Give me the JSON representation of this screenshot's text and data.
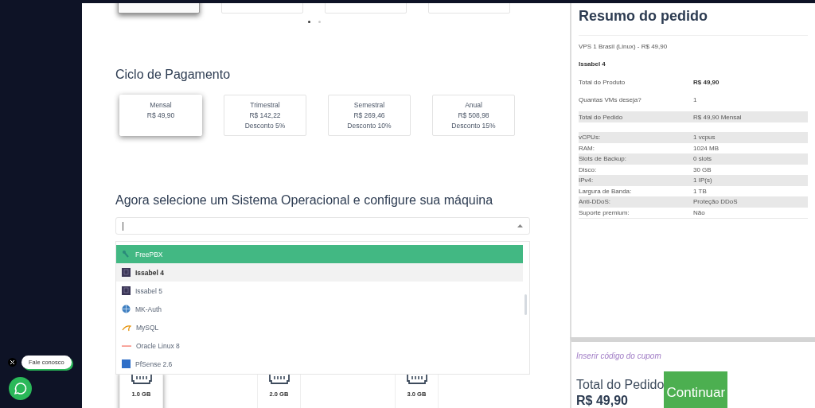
{
  "plan_cards": [
    {
      "selected": true
    },
    {
      "selected": false
    },
    {
      "selected": false
    },
    {
      "selected": false
    }
  ],
  "carousel_dots": [
    {
      "selected": true
    },
    {
      "selected": false
    }
  ],
  "billing": {
    "title": "Ciclo de Pagamento",
    "options": [
      {
        "name": "Mensal",
        "price": "R$ 49,90",
        "selected": true
      },
      {
        "name": "Trimestral",
        "price": "R$ 142,22",
        "discount": "Desconto 5%",
        "selected": false
      },
      {
        "name": "Semestral",
        "price": "R$ 269,46",
        "discount": "Desconto 10%",
        "selected": false
      },
      {
        "name": "Anual",
        "price": "R$ 508,98",
        "discount": "Desconto 15%",
        "selected": false
      }
    ]
  },
  "os": {
    "title": "Agora selecione um Sistema Operacional e configure sua máquina",
    "expanded": true,
    "items": [
      {
        "label": "FreePBX",
        "kind": "freepbx",
        "highlighted": true,
        "selected": false
      },
      {
        "label": "Issabel 4",
        "kind": "issabel",
        "highlighted": false,
        "selected": true
      },
      {
        "label": "Issabel 5",
        "kind": "issabel",
        "highlighted": false,
        "selected": false
      },
      {
        "label": "MK-Auth",
        "kind": "globe",
        "highlighted": false,
        "selected": false
      },
      {
        "label": "MySQL",
        "kind": "mysql",
        "highlighted": false,
        "selected": false
      },
      {
        "label": "Oracle Linux 8",
        "kind": "oracle",
        "highlighted": false,
        "selected": false
      },
      {
        "label": "PfSense 2.6",
        "kind": "pfsense",
        "highlighted": false,
        "selected": false
      }
    ]
  },
  "ram_options": [
    {
      "label": "1.0 GB",
      "selected": true
    },
    {
      "label": "2.0 GB",
      "selected": false
    },
    {
      "label": "3.0 GB",
      "selected": false
    }
  ],
  "summary": {
    "title": "Resumo do pedido",
    "product": "VPS 1 Brasil (Linux) - R$ 49,90",
    "os": "Issabel 4",
    "rows": [
      {
        "label": "Total do Produto",
        "value": "R$ 49,90",
        "kind": "bold"
      },
      {
        "label": "Quantas VMs deseja?",
        "value": "1",
        "kind": "plain"
      },
      {
        "label": "Total do Pedido",
        "value": "R$ 49,90 Mensal",
        "kind": "shaded"
      }
    ],
    "specs": [
      {
        "label": "vCPUs:",
        "value": "1 vcpus"
      },
      {
        "label": "RAM:",
        "value": "1024 MB"
      },
      {
        "label": "Slots de Backup:",
        "value": "0 slots"
      },
      {
        "label": "Disco:",
        "value": "30 GB"
      },
      {
        "label": "IPv4:",
        "value": "1 IP(s)"
      },
      {
        "label": "Largura de Banda:",
        "value": "1 TB"
      },
      {
        "label": "Anti-DDoS:",
        "value": "Proteção DDoS"
      },
      {
        "label": "Suporte premium:",
        "value": "Não"
      }
    ]
  },
  "checkout": {
    "coupon_link": "Inserir código do cupom",
    "total_label": "Total do Pedido",
    "total": "R$ 49,90",
    "button": "Continuar"
  },
  "chat": {
    "label": "Fale conosco"
  }
}
